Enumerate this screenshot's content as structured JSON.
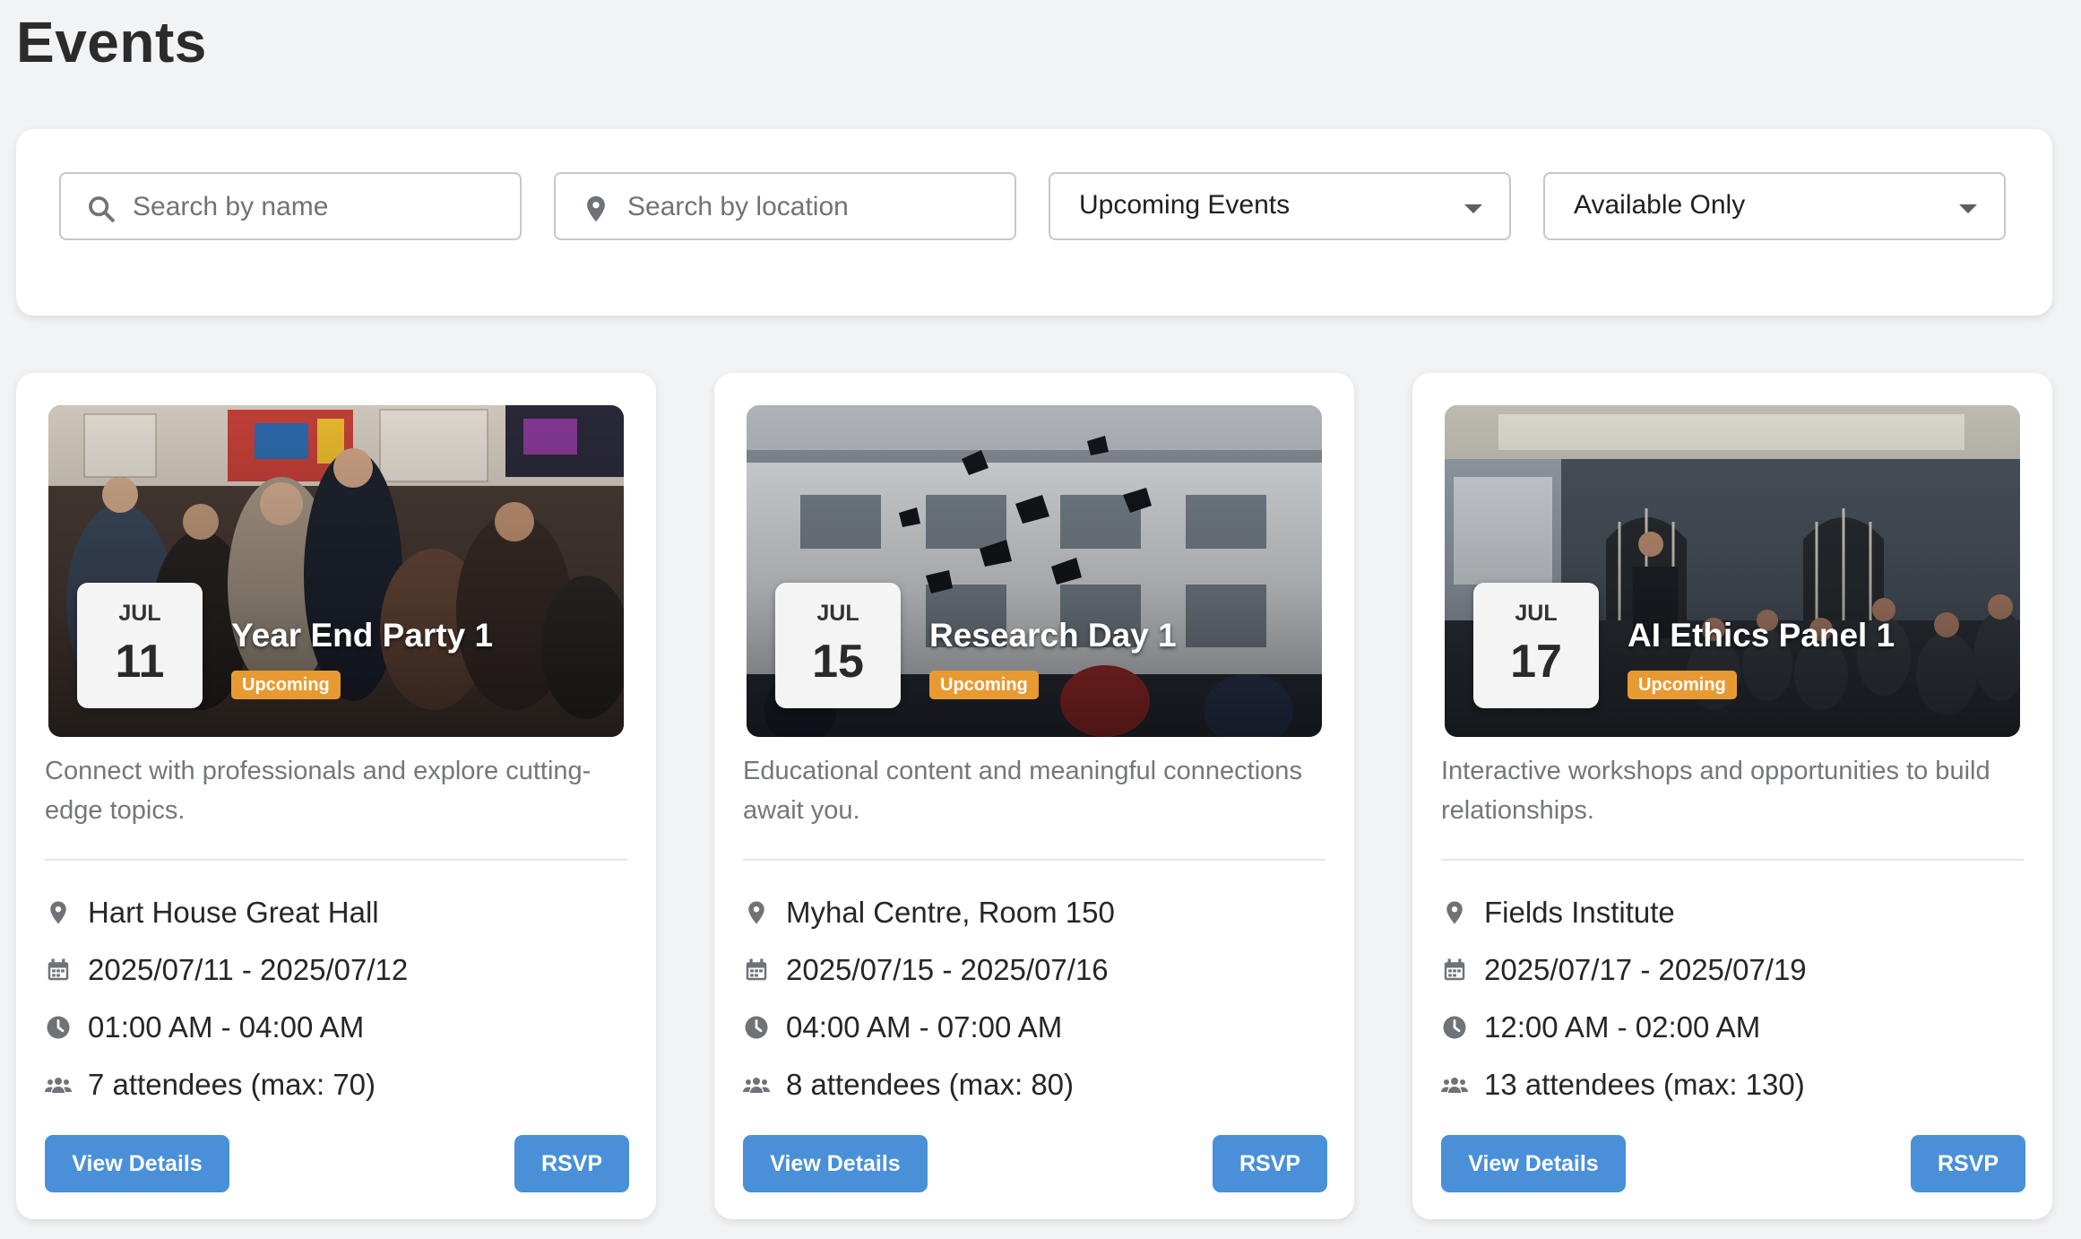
{
  "page": {
    "title": "Events"
  },
  "filters": {
    "name_placeholder": "Search by name",
    "location_placeholder": "Search by location",
    "time_select": "Upcoming Events",
    "availability_select": "Available Only"
  },
  "events": [
    {
      "month": "JUL",
      "day": "11",
      "title": "Year End Party 1",
      "status": "Upcoming",
      "description": "Connect with professionals and explore cutting-edge topics.",
      "location": "Hart House Great Hall",
      "dates": "2025/07/11 - 2025/07/12",
      "time": "01:00 AM - 04:00 AM",
      "attendees": "7 attendees (max: 70)",
      "details_label": "View Details",
      "rsvp_label": "RSVP"
    },
    {
      "month": "JUL",
      "day": "15",
      "title": "Research Day 1",
      "status": "Upcoming",
      "description": "Educational content and meaningful connections await you.",
      "location": "Myhal Centre, Room 150",
      "dates": "2025/07/15 - 2025/07/16",
      "time": "04:00 AM - 07:00 AM",
      "attendees": "8 attendees (max: 80)",
      "details_label": "View Details",
      "rsvp_label": "RSVP"
    },
    {
      "month": "JUL",
      "day": "17",
      "title": "AI Ethics Panel 1",
      "status": "Upcoming",
      "description": "Interactive workshops and opportunities to build relationships.",
      "location": "Fields Institute",
      "dates": "2025/07/17 - 2025/07/19",
      "time": "12:00 AM - 02:00 AM",
      "attendees": "13 attendees (max: 130)",
      "details_label": "View Details",
      "rsvp_label": "RSVP"
    }
  ],
  "colors": {
    "primary_button": "#4a90d9",
    "status_upcoming": "#e89a32",
    "background": "#f2f3f5"
  },
  "icons": [
    "search-icon",
    "location-pin-icon",
    "calendar-icon",
    "clock-icon",
    "attendees-icon",
    "dropdown-caret-icon"
  ]
}
